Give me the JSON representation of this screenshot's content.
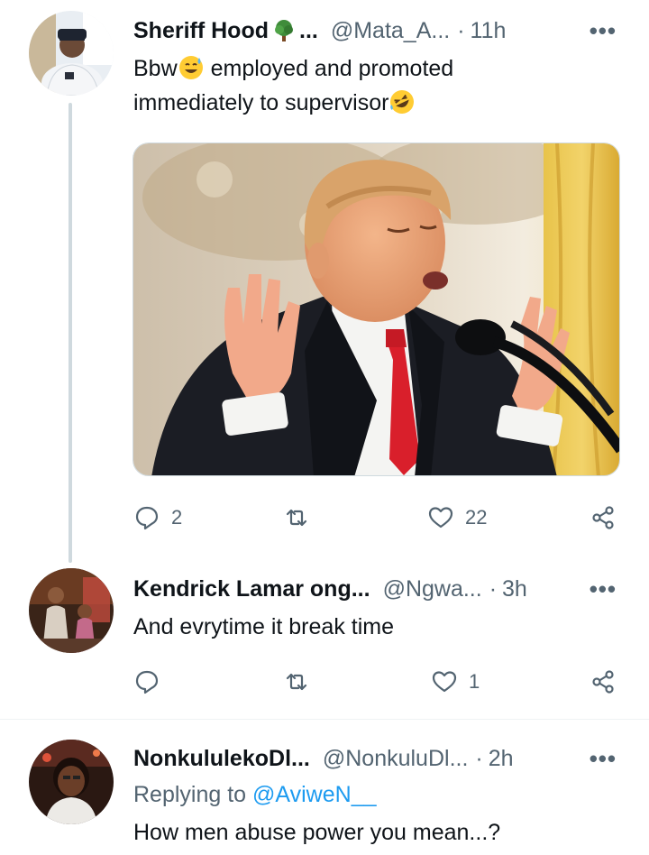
{
  "tweets": [
    {
      "display_name": "Sheriff Hood",
      "name_ellipsis": "...",
      "handle": "@Mata_A...",
      "separator": "·",
      "time": "11h",
      "text_line1": "Bbw",
      "text_line1b": " employed and promoted",
      "text_line2": "immediately to supervisor",
      "replies": "2",
      "retweets": "",
      "likes": "22"
    },
    {
      "display_name": "Kendrick Lamar ong...",
      "handle": "@Ngwa...",
      "separator": "·",
      "time": "3h",
      "text": "And evrytime it break time",
      "replies": "",
      "retweets": "",
      "likes": "1"
    },
    {
      "display_name": "NonkululekoDl...",
      "handle": "@NonkuluDl...",
      "separator": "·",
      "time": "2h",
      "replying_prefix": "Replying to ",
      "replying_to": "@AviweN__",
      "text": "How men abuse power you mean...?"
    }
  ],
  "more_label": "•••",
  "icons": {
    "reply": "reply-icon",
    "retweet": "retweet-icon",
    "like": "heart-icon",
    "share": "share-icon",
    "more": "more-icon"
  },
  "colors": {
    "text": "#0f1419",
    "secondary": "#536471",
    "link": "#1d9bf0",
    "border": "#cfd9de"
  }
}
